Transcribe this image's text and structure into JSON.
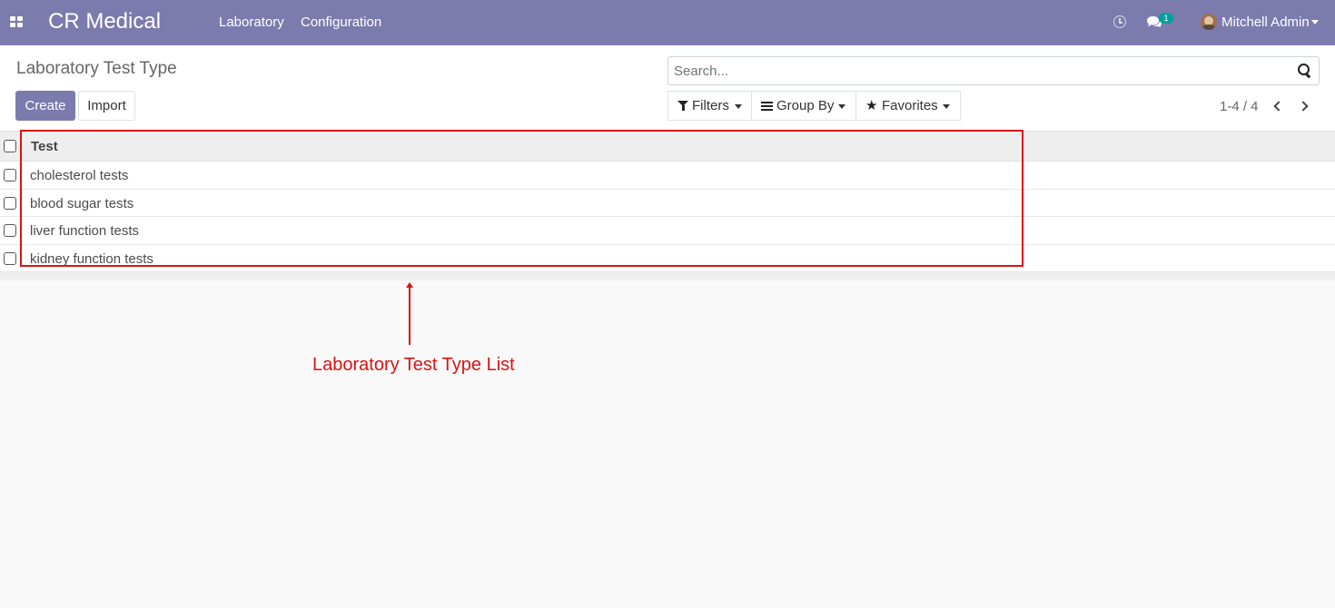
{
  "navbar": {
    "brand": "CR Medical",
    "menu": [
      "Laboratory",
      "Configuration"
    ],
    "chat_badge": "1",
    "user_name": "Mitchell Admin",
    "color": "#7c7bad"
  },
  "control_panel": {
    "breadcrumb": "Laboratory Test Type",
    "create_label": "Create",
    "import_label": "Import",
    "search_placeholder": "Search...",
    "filters_label": "Filters",
    "group_by_label": "Group By",
    "favorites_label": "Favorites",
    "pager_value": "1-4 / 4"
  },
  "list": {
    "column_header": "Test",
    "rows": [
      "cholesterol tests",
      "blood sugar tests",
      "liver function tests",
      "kidney function tests"
    ]
  },
  "annotation": {
    "label": "Laboratory Test Type List",
    "color": "#dd1111"
  }
}
